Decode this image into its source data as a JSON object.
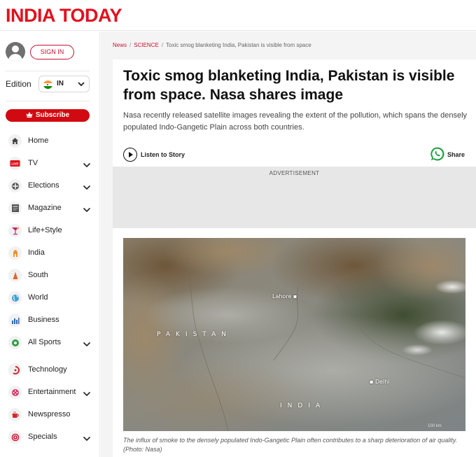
{
  "header": {
    "logo": "INDIA TODAY"
  },
  "sidebar": {
    "signin_label": "SIGN IN",
    "edition_label": "Edition",
    "edition_value": "IN",
    "subscribe_label": "Subscribe",
    "items": [
      {
        "label": "Home",
        "icon": "home-icon",
        "expandable": false
      },
      {
        "label": "TV",
        "icon": "live-tv-icon",
        "expandable": true
      },
      {
        "label": "Elections",
        "icon": "ballot-icon",
        "expandable": true
      },
      {
        "label": "Magazine",
        "icon": "magazine-icon",
        "expandable": true
      },
      {
        "label": "Life+Style",
        "icon": "cocktail-icon",
        "expandable": false
      },
      {
        "label": "India",
        "icon": "monument-icon",
        "expandable": false
      },
      {
        "label": "South",
        "icon": "temple-icon",
        "expandable": false
      },
      {
        "label": "World",
        "icon": "globe-icon",
        "expandable": false
      },
      {
        "label": "Business",
        "icon": "bar-chart-icon",
        "expandable": false
      },
      {
        "label": "All Sports",
        "icon": "sports-ball-icon",
        "expandable": true
      },
      {
        "label": "Technology",
        "icon": "technology-icon",
        "expandable": false
      },
      {
        "label": "Entertainment",
        "icon": "film-icon",
        "expandable": true
      },
      {
        "label": "Newspresso",
        "icon": "coffee-cup-icon",
        "expandable": false
      },
      {
        "label": "Specials",
        "icon": "specials-badge-icon",
        "expandable": true
      }
    ]
  },
  "breadcrumb": {
    "items": [
      "News",
      "SCIENCE",
      "Toxic smog blanketing India, Pakistan is visible from space"
    ]
  },
  "article": {
    "headline": "Toxic smog blanketing India, Pakistan is visible from space. Nasa shares image",
    "summary": "Nasa recently released satellite images revealing the extent of the pollution, which spans the densely populated Indo-Gangetic Plain across both countries.",
    "listen_label": "Listen to Story",
    "share_label": "Share",
    "ad_label": "ADVERTISEMENT",
    "image": {
      "label_pakistan": "PAKISTAN",
      "label_india": "INDIA",
      "city_lahore": "Lahore",
      "city_delhi": "Delhi",
      "scale_text": "100 km"
    },
    "caption": "The influx of smoke to the densely populated Indo-Gangetic Plain often contributes to a sharp deterioration of air quality. (Photo: Nasa)"
  },
  "colors": {
    "brand_red": "#e3101e",
    "subscribe_red": "#d10a11",
    "link_red": "#c8102e",
    "whatsapp_green": "#25a244"
  }
}
